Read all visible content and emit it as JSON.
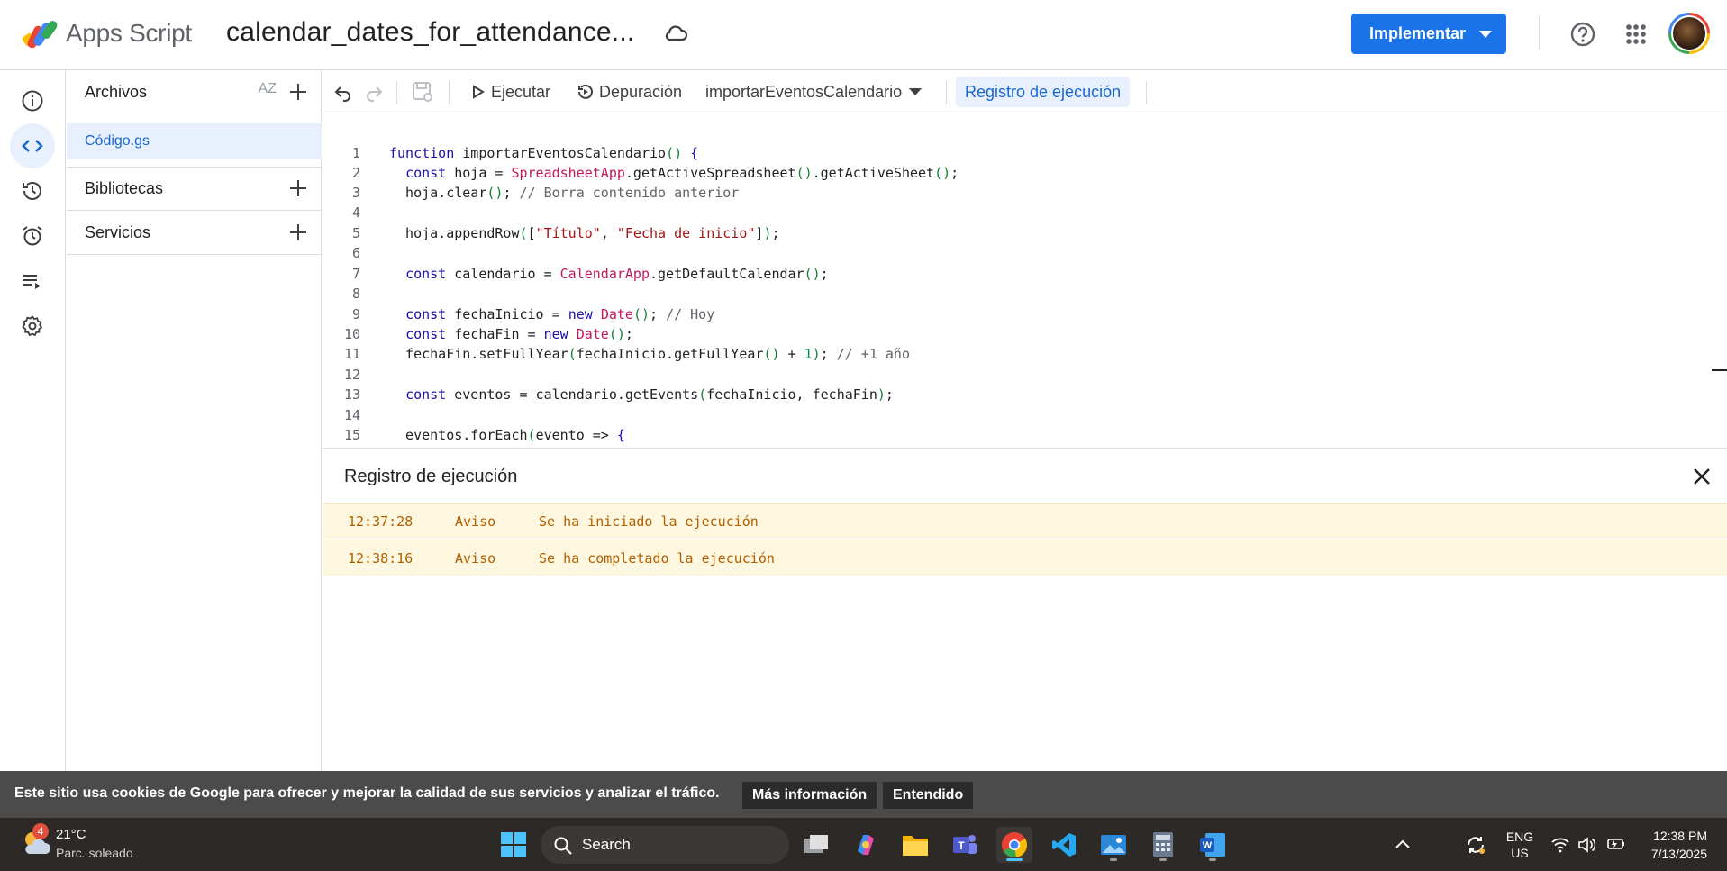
{
  "app": {
    "brand": "Apps Script",
    "project_title": "calendar_dates_for_attendance...",
    "deploy_label": "Implementar"
  },
  "files_panel": {
    "files_header": "Archivos",
    "sort_label": "AZ",
    "active_file": "Código.gs",
    "libraries_header": "Bibliotecas",
    "services_header": "Servicios"
  },
  "toolbar": {
    "run_label": "Ejecutar",
    "debug_label": "Depuración",
    "function_selected": "importarEventosCalendario",
    "log_toggle_label": "Registro de ejecución"
  },
  "editor": {
    "line_numbers": [
      "1",
      "2",
      "3",
      "4",
      "5",
      "6",
      "7",
      "8",
      "9",
      "10",
      "11",
      "12",
      "13",
      "14",
      "15"
    ]
  },
  "log": {
    "title": "Registro de ejecución",
    "rows": [
      {
        "time": "12:37:28",
        "level": "Aviso",
        "message": "Se ha iniciado la ejecución"
      },
      {
        "time": "12:38:16",
        "level": "Aviso",
        "message": "Se ha completado la ejecución"
      }
    ]
  },
  "cookie_banner": {
    "text": "Este sitio usa cookies de Google para ofrecer y mejorar la calidad de sus servicios y analizar el tráfico.",
    "more_info": "Más información",
    "accept": "Entendido"
  },
  "taskbar": {
    "weather_badge": "4",
    "weather_temp": "21°C",
    "weather_desc": "Parc. soleado",
    "search_label": "Search",
    "lang_line1": "ENG",
    "lang_line2": "US",
    "time": "12:38 PM",
    "date": "7/13/2025"
  },
  "colors": {
    "accent": "#1a73e8",
    "active_bg": "#e8f0fe",
    "log_bg": "#fef7e0",
    "log_text": "#b06000",
    "cookie_bg": "#4b4b4b",
    "taskbar_bg": "#2c2926"
  },
  "icons": [
    "apps-script-logo",
    "cloud-icon",
    "help-icon",
    "apps-grid-icon",
    "info-icon",
    "code-icon",
    "history-icon",
    "alarm-icon",
    "executions-icon",
    "settings-icon",
    "plus-icon",
    "undo-icon",
    "redo-icon",
    "save-icon",
    "play-icon",
    "debug-icon",
    "close-icon",
    "windows-icon",
    "search-icon"
  ]
}
